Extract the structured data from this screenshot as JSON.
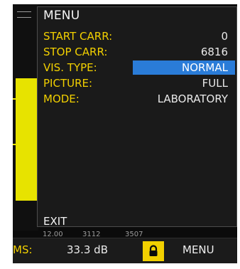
{
  "menu": {
    "title": "MENU",
    "items": [
      {
        "label": "START CARR:",
        "value": "0",
        "selected": false
      },
      {
        "label": "STOP CARR:",
        "value": "6816",
        "selected": false
      },
      {
        "label": "VIS. TYPE:",
        "value": "NORMAL",
        "selected": true
      },
      {
        "label": "PICTURE:",
        "value": "FULL",
        "selected": false
      },
      {
        "label": "MODE:",
        "value": "LABORATORY",
        "selected": false
      }
    ],
    "exit_label": "EXIT"
  },
  "graph": {
    "tick_labels": [
      "12.00",
      "3112",
      "3507"
    ]
  },
  "status_bar": {
    "ms_label": "MS:",
    "ms_value": "33.3 dB",
    "menu_label": "MENU",
    "lock_icon": "lock-icon"
  },
  "colors": {
    "label": "#f2d000",
    "selection": "#2a7cd8",
    "background": "#1a1a1a"
  }
}
